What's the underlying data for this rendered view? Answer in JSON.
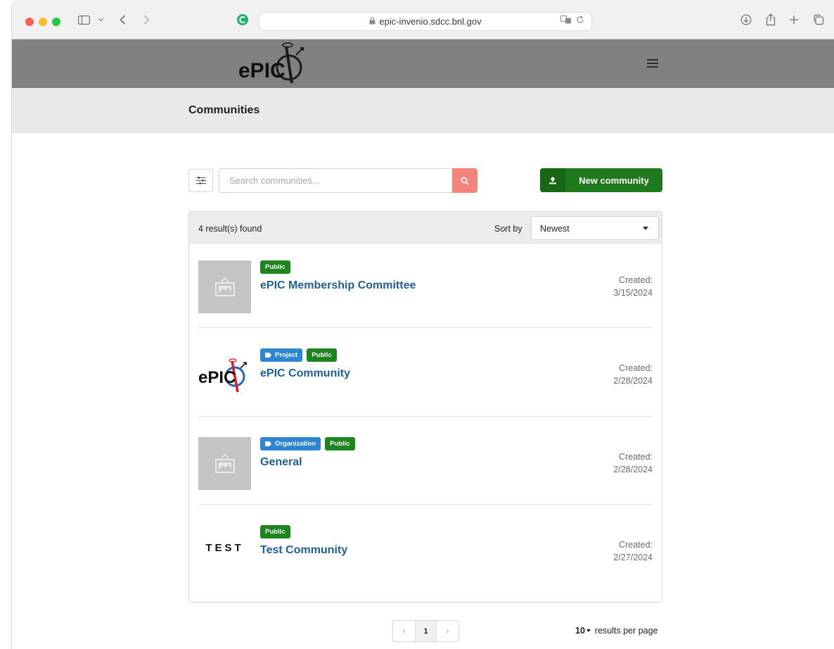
{
  "browser": {
    "url": "epic-invenio.sdcc.bnl.gov",
    "traffic_light_colors": [
      "#fe5f57",
      "#febc2e",
      "#28c840"
    ]
  },
  "header": {
    "logo_text": "ePIC",
    "menu_icon": "hamburger-icon"
  },
  "page": {
    "title": "Communities"
  },
  "search": {
    "placeholder": "Search communities...",
    "value": ""
  },
  "actions": {
    "new_community": "New community"
  },
  "results": {
    "count_text": "4 result(s) found",
    "sort_label": "Sort by",
    "sort_value": "Newest",
    "items": [
      {
        "title": "ePIC Membership Committee",
        "type_label": "",
        "visibility": "Public",
        "created_label": "Created:",
        "created_date": "3/15/2024",
        "logo": "placeholder-image"
      },
      {
        "title": "ePIC Community",
        "type_label": "Project",
        "visibility": "Public",
        "created_label": "Created:",
        "created_date": "2/28/2024",
        "logo": "epic-logo"
      },
      {
        "title": "General",
        "type_label": "Organization",
        "visibility": "Public",
        "created_label": "Created:",
        "created_date": "2/28/2024",
        "logo": "placeholder-image"
      },
      {
        "title": "Test Community",
        "type_label": "",
        "visibility": "Public",
        "created_label": "Created:",
        "created_date": "2/27/2024",
        "logo_text": "TEST"
      }
    ]
  },
  "pagination": {
    "prev": "‹",
    "current": "1",
    "next": "›",
    "per_page_value": "10",
    "per_page_label": "results per page"
  },
  "colors": {
    "header_bg": "#808182",
    "title_band_bg": "#e9e9e9",
    "search_button": "#f4847a",
    "new_button": "#1f7a1f",
    "public_label": "#1e841e",
    "type_label": "#2d86d1",
    "link": "#1f5f99"
  }
}
